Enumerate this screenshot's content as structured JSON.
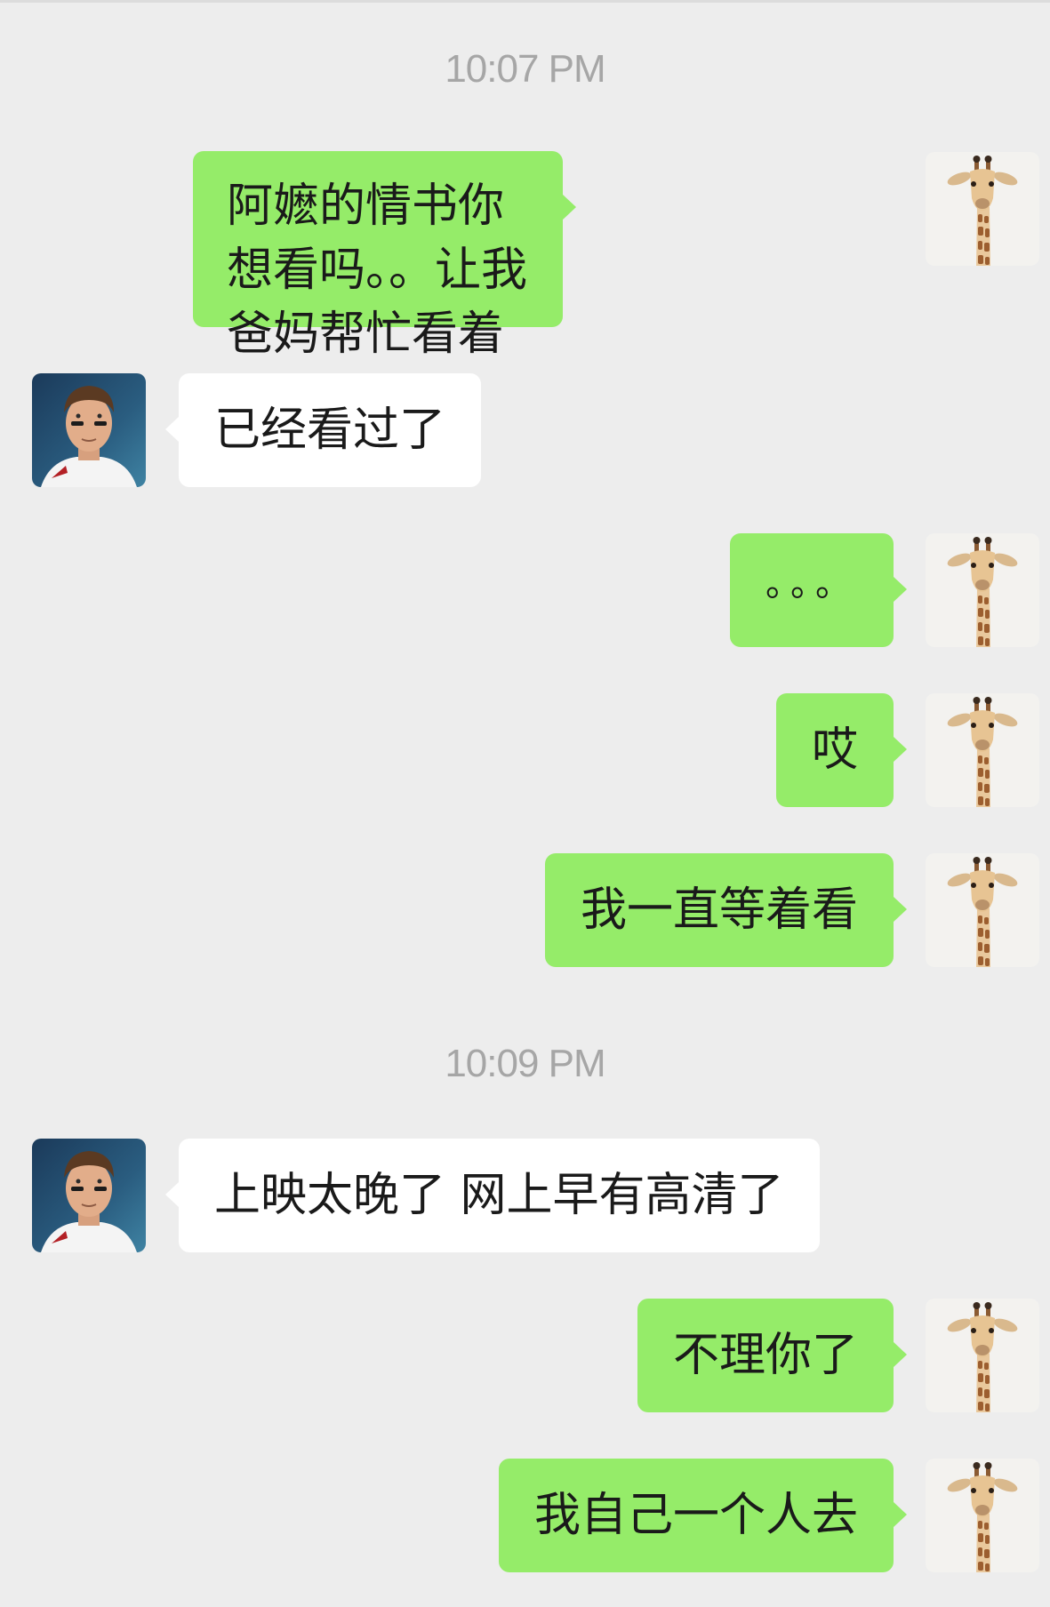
{
  "chat": {
    "timestamps": [
      "10:07 PM",
      "10:09 PM"
    ],
    "messages": [
      {
        "sender": "me",
        "text": "阿嬷的情书你想看吗。。让我爸妈帮忙看着宝宝?"
      },
      {
        "sender": "them",
        "text": "已经看过了"
      },
      {
        "sender": "me",
        "text": "。。。"
      },
      {
        "sender": "me",
        "text": "哎"
      },
      {
        "sender": "me",
        "text": "我一直等着看"
      },
      {
        "sender": "them",
        "text": "上映太晚了 网上早有高清了"
      },
      {
        "sender": "me",
        "text": "不理你了"
      },
      {
        "sender": "me",
        "text": "我自己一个人去"
      }
    ]
  },
  "avatars": {
    "me": "giraffe-avatar-icon",
    "them": "man-portrait-avatar-icon"
  },
  "colors": {
    "background": "#ededed",
    "my_bubble": "#95ec69",
    "their_bubble": "#ffffff",
    "timestamp": "#a6a6a6"
  }
}
